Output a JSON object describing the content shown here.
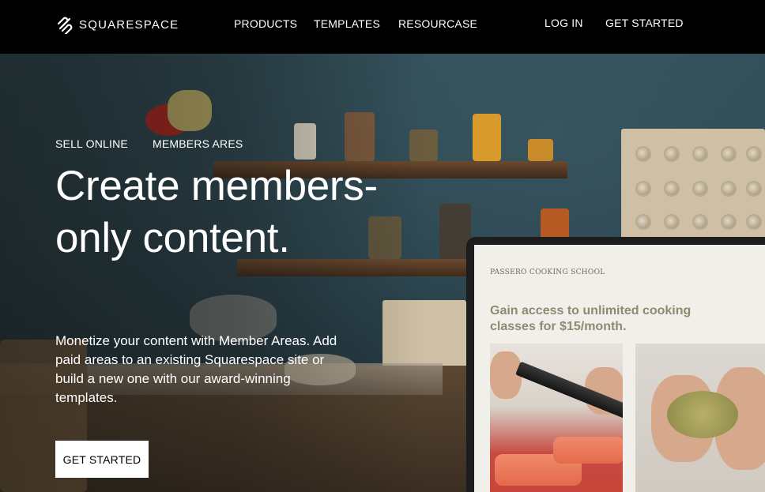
{
  "nav": {
    "logo_text": "SQUARESPACE",
    "logo_icon": "squarespace-logo-icon",
    "links": {
      "products": "PRODUCTS",
      "templates": "TEMPLATES",
      "resources": "RESOURCASE"
    },
    "login": "LOG IN",
    "get_started": "GET STARTED"
  },
  "hero": {
    "tabs": {
      "sell_online": "SELL ONLINE",
      "members_areas": "MEMBERS ARES"
    },
    "headline": "Create members-only content.",
    "body": "Monetize your content with Member Areas. Add paid areas to an existing Squarespace site or build a new one with our award-winning templates.",
    "cta": "GET STARTED"
  },
  "laptop": {
    "site_name": "PASSERO COOKING SCHOOL",
    "headline": "Gain access to unlimited cooking classes for $15/month."
  },
  "colors": {
    "nav_background": "#000000",
    "cta_background": "#ffffff",
    "laptop_headline": "#8b8b72"
  }
}
